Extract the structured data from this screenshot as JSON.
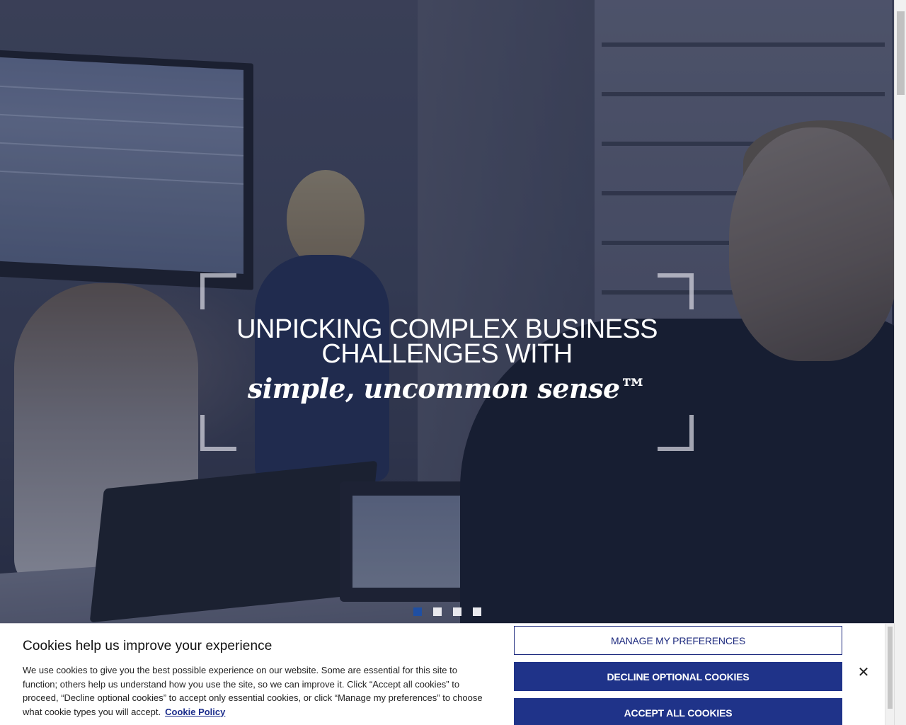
{
  "hero": {
    "headline_line1": "UNPICKING COMPLEX BUSINESS",
    "headline_line2": "CHALLENGES WITH",
    "tagline": "simple, uncommon sense™",
    "carousel": {
      "slide_count": 4,
      "active_slide": 1
    }
  },
  "cookie_banner": {
    "title": "Cookies help us improve your experience",
    "body": "We use cookies to give you the best possible experience on our website. Some are essential for this site to function; others help us understand how you use the site, so we can improve it. Click “Accept all cookies” to proceed, “Decline optional cookies” to accept only essential cookies, or click “Manage my preferences” to choose what cookie types you will accept.",
    "policy_link": "Cookie Policy",
    "manage_label": "MANAGE MY PREFERENCES",
    "decline_label": "DECLINE OPTIONAL COOKIES",
    "accept_label": "ACCEPT ALL COOKIES",
    "close_icon": "close-icon"
  },
  "colors": {
    "accent": "#1f3389",
    "active_dot": "#1f4fa3",
    "hero_overlay": "#1e243c"
  }
}
